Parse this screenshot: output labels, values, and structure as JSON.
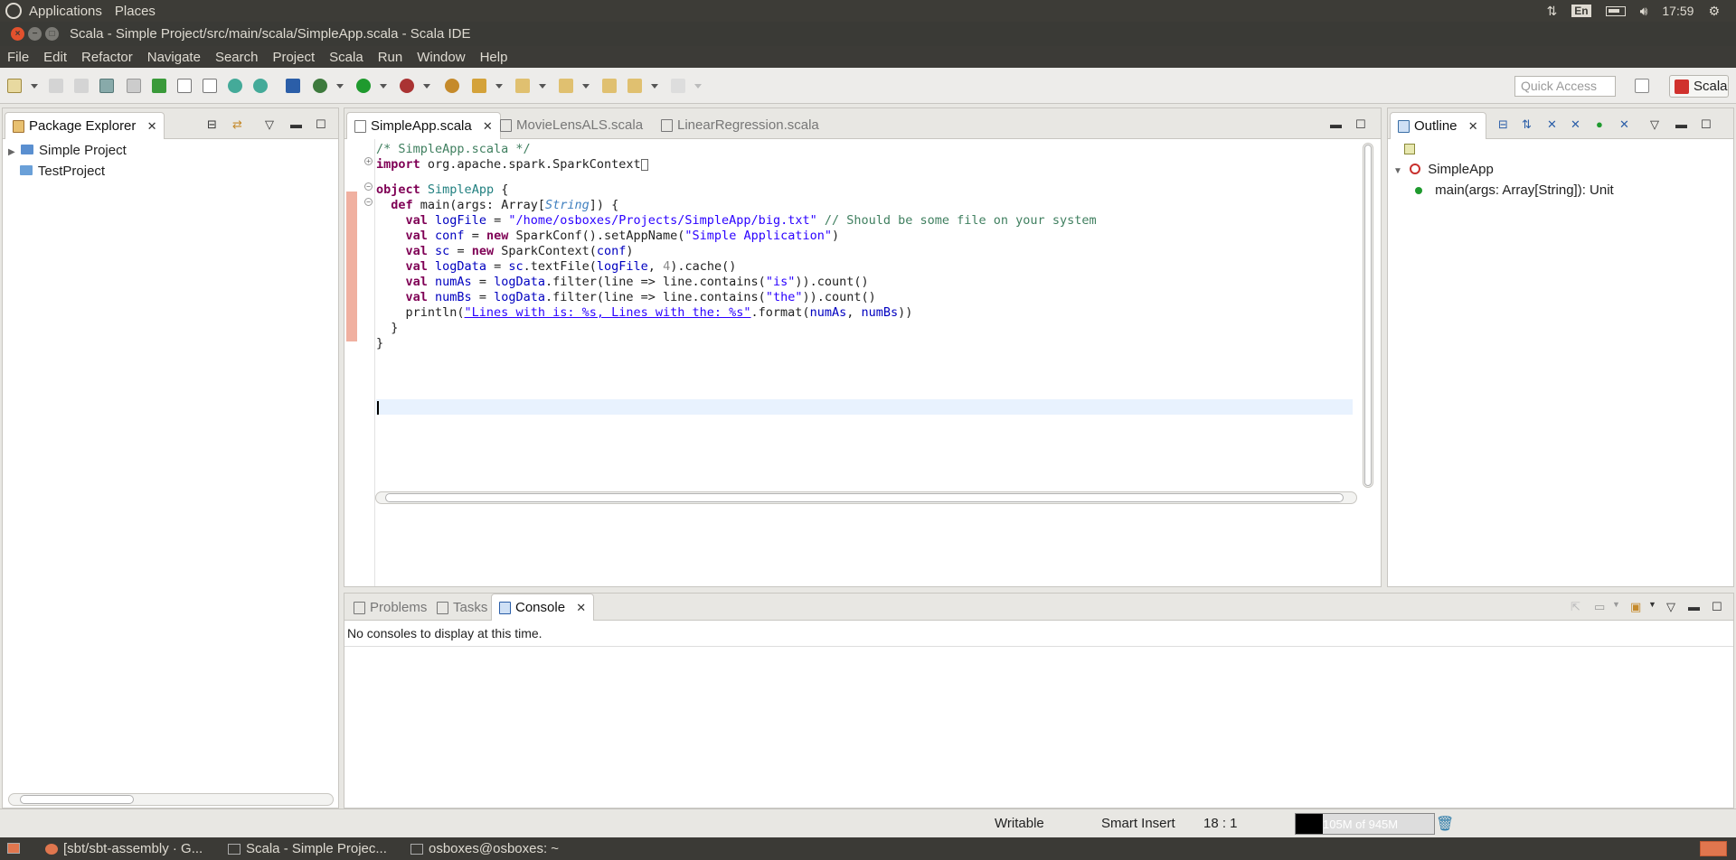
{
  "system_panel": {
    "menus": [
      "Applications",
      "Places"
    ],
    "keyboard_layout": "En",
    "clock": "17:59"
  },
  "window": {
    "title": "Scala - Simple Project/src/main/scala/SimpleApp.scala - Scala IDE"
  },
  "menubar": [
    "File",
    "Edit",
    "Refactor",
    "Navigate",
    "Search",
    "Project",
    "Scala",
    "Run",
    "Window",
    "Help"
  ],
  "toolbar": {
    "quick_access_placeholder": "Quick Access",
    "perspective_label": "Scala"
  },
  "package_explorer": {
    "tab_label": "Package Explorer",
    "items": [
      "Simple Project",
      "TestProject"
    ]
  },
  "editor": {
    "tabs": [
      "SimpleApp.scala",
      "MovieLensALS.scala",
      "LinearRegression.scala"
    ],
    "active_tab": "SimpleApp.scala"
  },
  "outline": {
    "tab_label": "Outline",
    "object_name": "SimpleApp",
    "method_signature": "main(args: Array[String]): Unit"
  },
  "console_panel": {
    "tabs": [
      "Problems",
      "Tasks",
      "Console"
    ],
    "message": "No consoles to display at this time."
  },
  "statusbar": {
    "writable": "Writable",
    "insert_mode": "Smart Insert",
    "position": "18 : 1",
    "heap": "105M of 945M"
  },
  "taskbar": {
    "items": [
      "[sbt/sbt-assembly · G...",
      "Scala - Simple Projec...",
      "osboxes@osboxes: ~"
    ]
  },
  "code_lines": [
    "/* SimpleApp.scala */",
    "import org.apache.spark.SparkContext",
    "",
    "object SimpleApp {",
    "  def main(args: Array[String]) {",
    "    val logFile = \"/home/osboxes/Projects/SimpleApp/big.txt\" // Should be some file on your system",
    "    val conf = new SparkConf().setAppName(\"Simple Application\")",
    "    val sc = new SparkContext(conf)",
    "    val logData = sc.textFile(logFile, 4).cache()",
    "    val numAs = logData.filter(line => line.contains(\"is\")).count()",
    "    val numBs = logData.filter(line => line.contains(\"the\")).count()",
    "    println(\"Lines with is: %s, Lines with the: %s\".format(numAs, numBs))",
    "  }",
    "}"
  ]
}
